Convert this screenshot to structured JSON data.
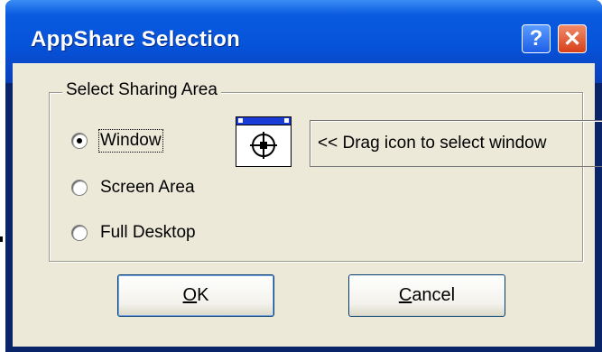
{
  "window": {
    "title": "AppShare Selection",
    "help_glyph": "?",
    "close_glyph": "✕"
  },
  "group": {
    "label": "Select Sharing Area",
    "options": [
      {
        "label": "Window",
        "checked": true
      },
      {
        "label": "Screen Area",
        "checked": false
      },
      {
        "label": "Full Desktop",
        "checked": false
      }
    ],
    "finder_icon": "crosshair-window-finder-icon",
    "hint": "<< Drag icon to select window"
  },
  "buttons": {
    "ok_mnemonic": "O",
    "ok_rest": "K",
    "cancel_mnemonic": "C",
    "cancel_rest": "ancel"
  },
  "colors": {
    "titlebar": "#0553d9",
    "dialog_face": "#ece9d8",
    "close_button": "#d6401a",
    "finder_bar": "#1a3cd6"
  }
}
